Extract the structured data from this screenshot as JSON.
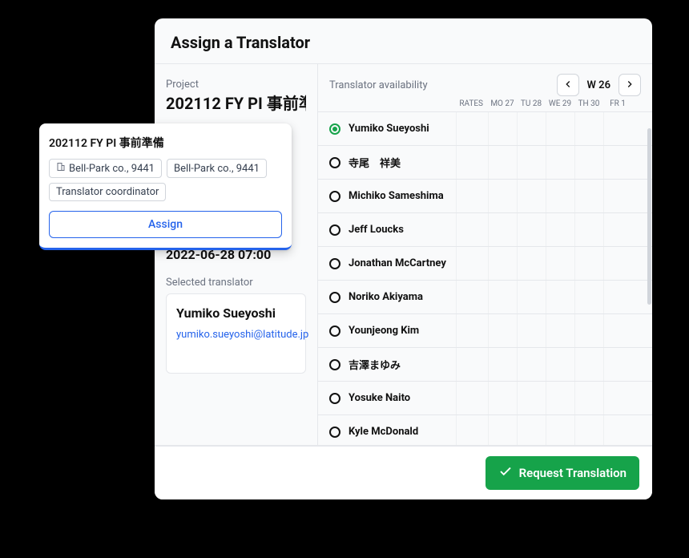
{
  "modal": {
    "title": "Assign a Translator",
    "project_label": "Project",
    "project_name": "202112 FY PI 事前準",
    "project_name_full": "202112 FY PI 事前準備",
    "datetime": "2022-06-28 07:00",
    "selected_label": "Selected translator",
    "selected_translator": {
      "name": "Yumiko Sueyoshi",
      "email": "yumiko.sueyoshi@latitude.jp"
    },
    "availability_label": "Translator availability",
    "week_label": "W 26",
    "columns": {
      "rates": "RATES",
      "days": [
        "MO 27",
        "TU 28",
        "WE 29",
        "TH 30",
        "FR 1"
      ]
    },
    "translators": [
      {
        "name": "Yumiko Sueyoshi",
        "selected": true
      },
      {
        "name": "寺尾　祥美",
        "selected": false
      },
      {
        "name": "Michiko Sameshima",
        "selected": false
      },
      {
        "name": "Jeff Loucks",
        "selected": false
      },
      {
        "name": "Jonathan McCartney",
        "selected": false
      },
      {
        "name": "Noriko Akiyama",
        "selected": false
      },
      {
        "name": "Younjeong Kim",
        "selected": false
      },
      {
        "name": "吉澤まゆみ",
        "selected": false
      },
      {
        "name": "Yosuke Naito",
        "selected": false
      },
      {
        "name": "Kyle McDonald",
        "selected": false
      }
    ],
    "request_button": "Request Translation"
  },
  "popover": {
    "title": "202112 FY PI 事前準備",
    "tags": [
      {
        "label": "Bell-Park co., 9441",
        "icon": true
      },
      {
        "label": "Bell-Park co., 9441",
        "icon": false
      },
      {
        "label": "Translator coordinator",
        "icon": false
      }
    ],
    "assign_label": "Assign"
  }
}
